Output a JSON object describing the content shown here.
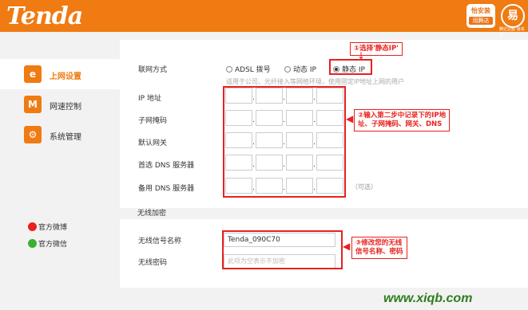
{
  "header": {
    "logo": "Tenda",
    "badge1_line1": "怡安装",
    "badge1_line2": "用腾达",
    "badge2_text": "易",
    "badge2_sub": "腾达云服 易来选"
  },
  "sidebar": {
    "items": [
      {
        "label": "上网设置",
        "icon": "e",
        "active": true
      },
      {
        "label": "网速控制",
        "icon": "M",
        "active": false
      },
      {
        "label": "系统管理",
        "icon": "⚙",
        "active": false
      }
    ],
    "weibo": "官方微博",
    "weixin": "官方微信"
  },
  "wan": {
    "mode_label": "联网方式",
    "options": [
      "ADSL 拨号",
      "动态 IP",
      "静态 IP"
    ],
    "selected": "静态 IP",
    "hint": "适用于公司、光纤接入等网络环境，使用固定IP地址上网的用户",
    "fields": [
      "IP 地址",
      "子网掩码",
      "默认网关",
      "首选 DNS 服务器",
      "备用 DNS 服务器"
    ],
    "optional": "（可选）"
  },
  "wireless": {
    "section_title": "无线加密",
    "ssid_label": "无线信号名称",
    "ssid_value": "Tenda_090C70",
    "password_label": "无线密码",
    "password_placeholder": "此项为空表示不加密"
  },
  "annotations": {
    "a1": "①选择'静态IP'",
    "a2_line1": "②输入第二步中记录下的IP地",
    "a2_line2": "址、子网掩码、网关、DNS",
    "a3_line1": "③修改您的无线",
    "a3_line2": "信号名称、密码"
  },
  "watermark": "www.xiqb.com",
  "colors": {
    "brand": "#f07b12",
    "annotation": "#e8211e"
  }
}
